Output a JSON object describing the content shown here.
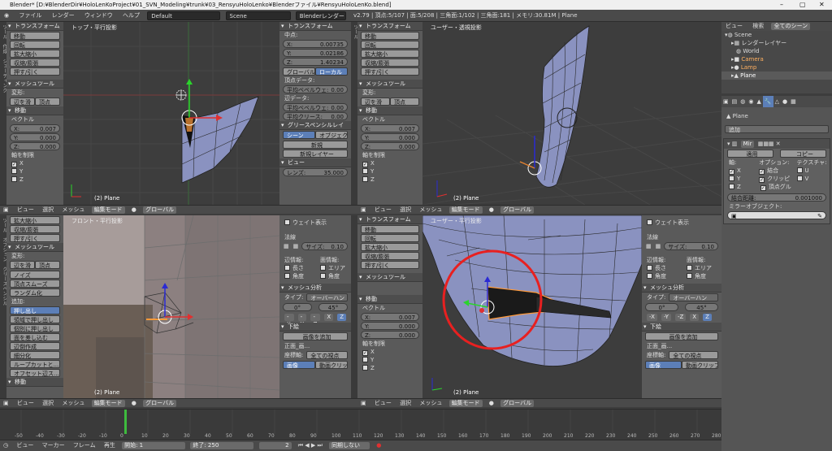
{
  "window": {
    "title": "Blender* [D:¥BlenderDir¥HoloLenKoProject¥01_SVN_Modeling¥trunk¥03_RensyuHoloLenko¥Blenderファイル¥RensyuHoloLenKo.blend]"
  },
  "menubar": {
    "menus": [
      "ファイル",
      "レンダー",
      "ウィンドウ",
      "ヘルプ"
    ],
    "layout": "Default",
    "scene": "Scene",
    "engine": "Blenderレンダー",
    "stats": "v2.79 | 頂点:5/107 | 面:5/208 | 三角面:1/102 | 三角面:181 | メモリ:30.81M | Plane"
  },
  "tool_panel_top": {
    "transform_title": "トランスフォーム",
    "transform_buttons": [
      "移動",
      "回転",
      "拡大縮小",
      "収縮/膨張",
      "押す/引く"
    ],
    "mesh_tools_title": "メッシュツール",
    "deform_label": "変形:",
    "deform_buttons": [
      "辺を滑",
      "頂点"
    ],
    "move_title": "移動",
    "vector_label": "ベクトル",
    "vec": [
      {
        "axis": "X:",
        "val": "0.007"
      },
      {
        "axis": "Y:",
        "val": "0.000"
      },
      {
        "axis": "Z:",
        "val": "0.000"
      }
    ],
    "constraint_label": "軸を制限",
    "axes": [
      "X",
      "Y",
      "Z"
    ]
  },
  "properties_top": {
    "transform_title": "トランスフォーム",
    "median_label": "中点:",
    "median": [
      {
        "axis": "X:",
        "val": "0.00735"
      },
      {
        "axis": "Y:",
        "val": "0.02186"
      },
      {
        "axis": "Z:",
        "val": "1.40234"
      }
    ],
    "tabs": [
      "グローバル",
      "ローカル"
    ],
    "vertex_data_label": "頂点データ:",
    "bevel_weight_v": "平均ベベルウェ:",
    "bevel_weight_v_val": "0.00",
    "edge_data_label": "辺データ:",
    "bevel_weight_e": "平均ベベルウェ:",
    "bevel_weight_e_val": "0.00",
    "crease": "平均クリース:",
    "crease_val": "0.00",
    "gp_title": "グリースペンシルレイ",
    "gp_tabs": [
      "シーン",
      "オブジェクト"
    ],
    "new_label": "新規",
    "new_layer": "新規レイヤー",
    "view_title": "ビュー",
    "lens_label": "レンズ:",
    "lens_val": "35.000"
  },
  "vp_top_left": {
    "name": "トップ・平行投影",
    "object": "(2) Plane"
  },
  "vp_top_right": {
    "name": "ユーザー・透視投影",
    "object": "(2) Plane"
  },
  "vp_bottom_left": {
    "name": "フロント・平行投影",
    "object": "(2) Plane"
  },
  "vp_bottom_right": {
    "name": "ユーザー・平行投影",
    "object": "(2) Plane"
  },
  "right_tool_panel": {
    "transform_title": "トランスフォーム",
    "buttons": [
      "移動",
      "回転",
      "拡大縮小",
      "収縮/膨張",
      "押す/引く"
    ],
    "mesh_tools_title": "メッシュツール",
    "move_title": "移動",
    "vector_label": "ベクトル",
    "vec": [
      {
        "axis": "X:",
        "val": "0.007"
      },
      {
        "axis": "Y:",
        "val": "0.000"
      },
      {
        "axis": "Z:",
        "val": "0.000"
      }
    ],
    "constraint_label": "軸を制限",
    "axes": [
      "X",
      "Y",
      "Z"
    ]
  },
  "tool_panel_bottom": {
    "buttons_top": [
      "拡大縮小",
      "収縮/膨張",
      "押す/引く"
    ],
    "mesh_tools_title": "メッシュツール",
    "deform_label": "変形:",
    "deform_buttons": [
      "辺を滑",
      "頂点"
    ],
    "deform_list": [
      "ノイズ",
      "頂点スムーズ",
      "ランダム化"
    ],
    "add_label": "追加:",
    "add_list": [
      "押し出し",
      "領域で押し出し",
      "個別に押し出し",
      "面を差し込む",
      "辺倒作成",
      "細分化",
      "ループカットと...",
      "オフセット辺ス..."
    ],
    "move_title": "移動"
  },
  "props_bottom_left": {
    "weight_label": "ウェイト表示",
    "normal_label": "法線",
    "size_label": "サイズ:",
    "size_val": "0.10",
    "edge_info": "辺情報:",
    "face_info": "面情報:",
    "length": "長さ",
    "area": "エリア",
    "angle": "角度",
    "angle2": "角度",
    "mesh_analysis": "メッシュ分析",
    "type_label": "タイプ:",
    "type_val": "オーバーハン",
    "deg0": "0°",
    "deg45": "45°",
    "bg_title": "下絵",
    "add_image": "画像を追加",
    "front_label": "正面_画...",
    "axis_label": "座標軸:",
    "axis_val": "全ての視点",
    "image_tab": "画像",
    "movie_tab": "動画クリップ"
  },
  "outliner": {
    "tabs": [
      "ビュー",
      "検索"
    ],
    "scene_select": "全てのシーン",
    "items": [
      "Scene",
      "レンダーレイヤー",
      "World",
      "Camera",
      "Lamp",
      "Plane"
    ]
  },
  "modifiers": {
    "object_name": "Plane",
    "add_modifier": "追加",
    "modifier_name": "Mir",
    "apply": "適用",
    "copy": "コピー",
    "axis_label": "軸:",
    "option_label": "オプション:",
    "texture_label": "テクスチャ:",
    "axis_x": "X",
    "axis_y": "Y",
    "axis_z": "Z",
    "opt_merge": "結合",
    "opt_clip": "クリッピ",
    "opt_vgroup": "頂点グル",
    "tex_u": "U",
    "tex_v": "V",
    "merge_dist_label": "結合距離:",
    "merge_dist_val": "0.001000",
    "mirror_obj_label": "ミラーオブジェクト:"
  },
  "headers": {
    "view": "ビュー",
    "select": "選択",
    "mesh": "メッシュ",
    "mode": "編集モード",
    "pivot": "グローバル"
  },
  "timeline": {
    "ticks": [
      "-50",
      "-40",
      "-30",
      "-20",
      "-10",
      "0",
      "10",
      "20",
      "30",
      "40",
      "50",
      "60",
      "70",
      "80",
      "90",
      "100",
      "110",
      "120",
      "130",
      "140",
      "150",
      "160",
      "170",
      "180",
      "190",
      "200",
      "210",
      "220",
      "230",
      "240",
      "250",
      "260",
      "270",
      "280"
    ],
    "menus": [
      "ビュー",
      "マーカー",
      "フレーム",
      "再生"
    ],
    "start_label": "開始:",
    "start_val": "1",
    "end_label": "終了:",
    "end_val": "250",
    "current": "2",
    "sync": "同期しない"
  }
}
